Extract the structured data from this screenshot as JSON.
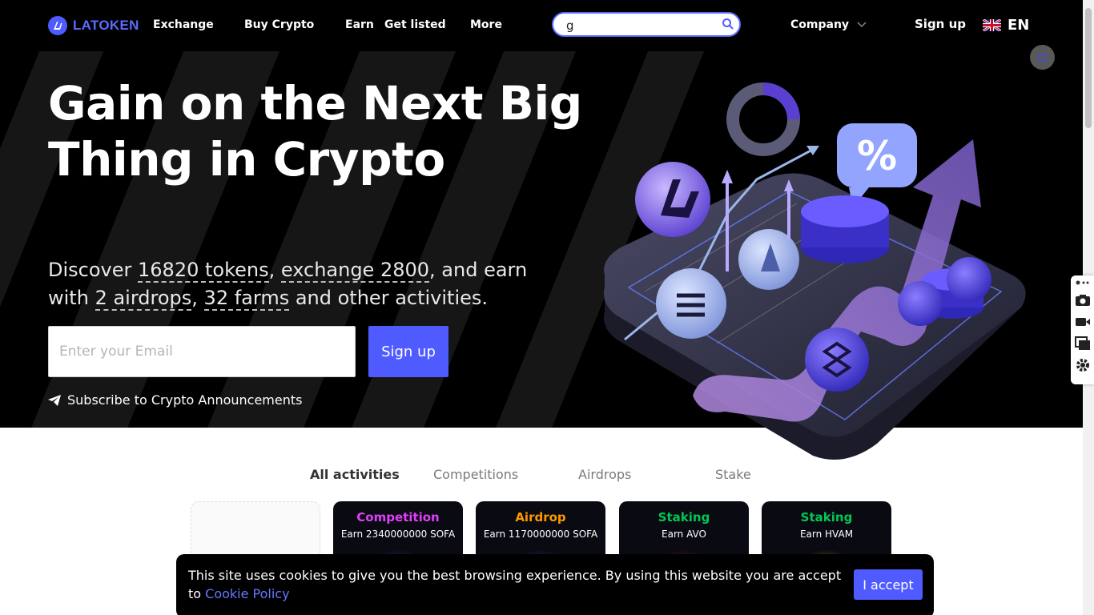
{
  "header": {
    "logo_text": "LATOKEN",
    "nav": [
      "Exchange",
      "Buy Crypto",
      "Earn",
      "Get listed",
      "More"
    ],
    "search": {
      "value": "g",
      "placeholder": ""
    },
    "company_label": "Company",
    "signup_label": "Sign up",
    "language": "EN"
  },
  "hero": {
    "title": "Gain on the Next Big Thing in Crypto",
    "sub_discover": "Discover",
    "sub_tokens": "16820 tokens",
    "sub_exchange": "exchange 2800",
    "sub_and_earn": ", and earn with",
    "sub_airdrops": "2 airdrops",
    "sub_farms": "32 farms",
    "sub_rest": "and other activities.",
    "email_placeholder": "Enter your Email",
    "signup_label": "Sign up",
    "subscribe_label": "Subscribe to Crypto Announcements"
  },
  "activities": {
    "tabs": [
      "All activities",
      "Competitions",
      "Airdrops",
      "Stake"
    ],
    "cards": [
      {
        "type": "Competition",
        "earn": "Earn 2340000000 SOFA",
        "color": "#e040fb"
      },
      {
        "type": "Airdrop",
        "earn": "Earn 1170000000 SOFA",
        "color": "#ff9800"
      },
      {
        "type": "Staking",
        "earn": "Earn AVO",
        "color": "#00c853"
      },
      {
        "type": "Staking",
        "earn": "Earn HVAM",
        "color": "#00c853"
      }
    ]
  },
  "cookie": {
    "text": "This site uses cookies to give you the best browsing experience. By using this website you are accept to",
    "link": "Cookie Policy",
    "accept_label": "I accept"
  },
  "colors": {
    "brand": "#4f5bff",
    "background_dark": "#000000"
  }
}
